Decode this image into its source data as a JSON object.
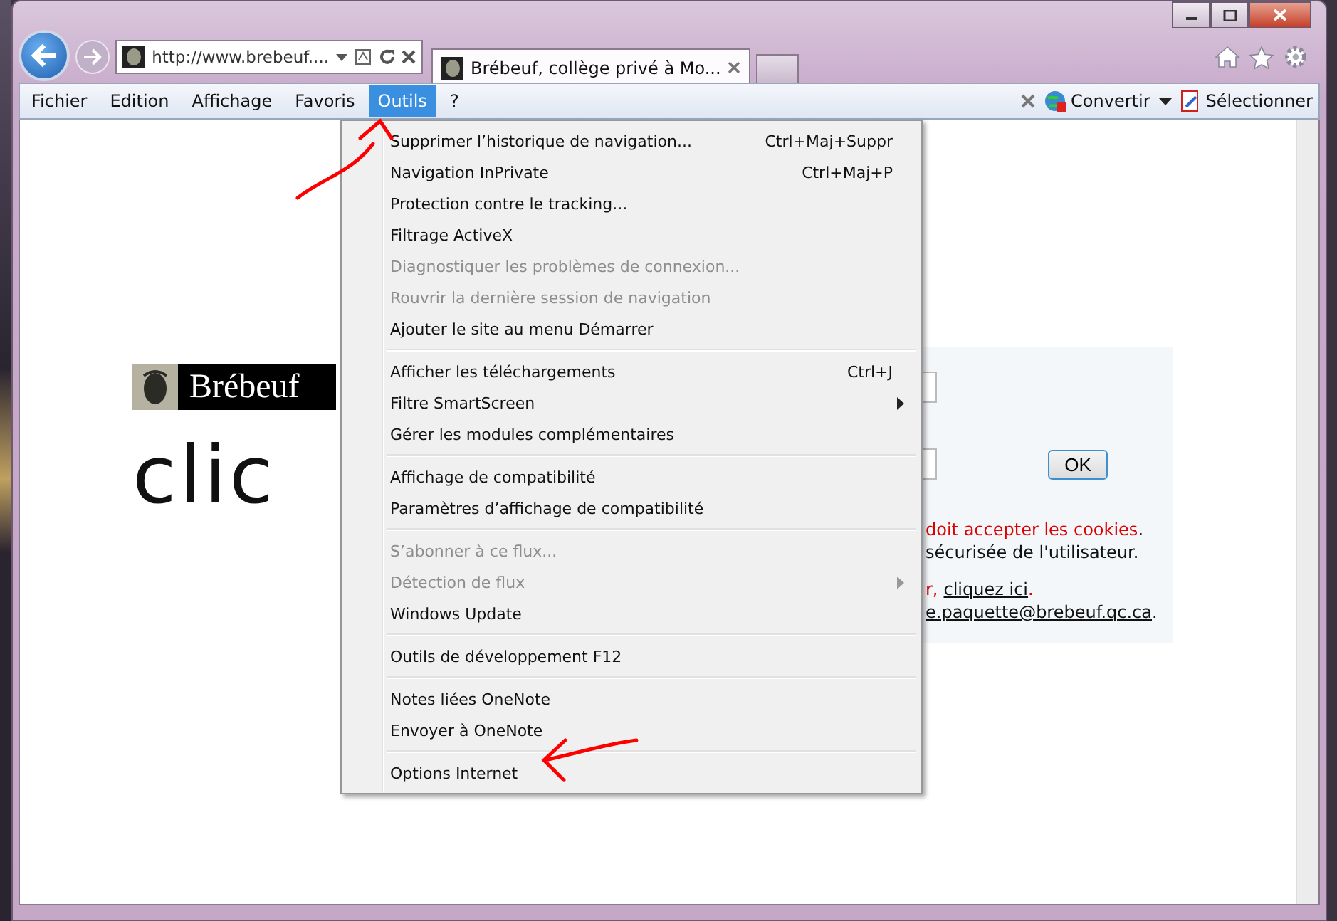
{
  "window": {
    "address": "http://www.brebeuf....",
    "tab_title": "Brébeuf, collège privé à Mo..."
  },
  "menu_bar": {
    "items": [
      {
        "label": "Fichier",
        "selected": false
      },
      {
        "label": "Edition",
        "selected": false
      },
      {
        "label": "Affichage",
        "selected": false
      },
      {
        "label": "Favoris",
        "selected": false
      },
      {
        "label": "Outils",
        "selected": true
      },
      {
        "label": "?",
        "selected": false
      }
    ],
    "convert": "Convertir",
    "select": "Sélectionner"
  },
  "dropdown": {
    "groups": [
      [
        {
          "label": "Supprimer l’historique de navigation...",
          "shortcut": "Ctrl+Maj+Suppr",
          "disabled": false,
          "submenu": false
        },
        {
          "label": "Navigation InPrivate",
          "shortcut": "Ctrl+Maj+P",
          "disabled": false,
          "submenu": false
        },
        {
          "label": "Protection contre le tracking...",
          "disabled": false,
          "submenu": false
        },
        {
          "label": "Filtrage ActiveX",
          "disabled": false,
          "submenu": false
        },
        {
          "label": "Diagnostiquer les problèmes de connexion...",
          "disabled": true,
          "submenu": false
        },
        {
          "label": "Rouvrir la dernière session de navigation",
          "disabled": true,
          "submenu": false
        },
        {
          "label": "Ajouter le site au menu Démarrer",
          "disabled": false,
          "submenu": false
        }
      ],
      [
        {
          "label": "Afficher les téléchargements",
          "shortcut": "Ctrl+J",
          "disabled": false,
          "submenu": false
        },
        {
          "label": "Filtre SmartScreen",
          "disabled": false,
          "submenu": true
        },
        {
          "label": "Gérer les modules complémentaires",
          "disabled": false,
          "submenu": false
        }
      ],
      [
        {
          "label": "Affichage de compatibilité",
          "disabled": false,
          "submenu": false
        },
        {
          "label": "Paramètres d’affichage de compatibilité",
          "disabled": false,
          "submenu": false
        }
      ],
      [
        {
          "label": "S’abonner à ce flux...",
          "disabled": true,
          "submenu": false
        },
        {
          "label": "Détection de flux",
          "disabled": true,
          "submenu": true
        },
        {
          "label": "Windows Update",
          "disabled": false,
          "submenu": false
        }
      ],
      [
        {
          "label": "Outils de développement F12",
          "disabled": false,
          "submenu": false
        }
      ],
      [
        {
          "label": "Notes liées OneNote",
          "disabled": false,
          "submenu": false
        },
        {
          "label": "Envoyer à OneNote",
          "disabled": false,
          "submenu": false
        }
      ],
      [
        {
          "label": "Options Internet",
          "disabled": false,
          "submenu": false
        }
      ]
    ]
  },
  "page": {
    "logo_text": "Brébeuf",
    "heading": "clic",
    "ok_button": "OK",
    "notice_lines": [
      [
        {
          "text": "doit accepter les cookies",
          "kind": "alert"
        },
        {
          "text": ".",
          "kind": "plain"
        }
      ],
      [
        {
          "text": "sécurisée de l'utilisateur.",
          "kind": "plain"
        }
      ],
      [
        {
          "text": "r,",
          "kind": "alert"
        },
        {
          "text": "cliquez ici",
          "kind": "link"
        },
        {
          "text": ".",
          "kind": "alert"
        }
      ],
      [
        {
          "text": "e.paquette@brebeuf.qc.ca",
          "kind": "link"
        },
        {
          "text": ".",
          "kind": "plain"
        }
      ]
    ]
  }
}
